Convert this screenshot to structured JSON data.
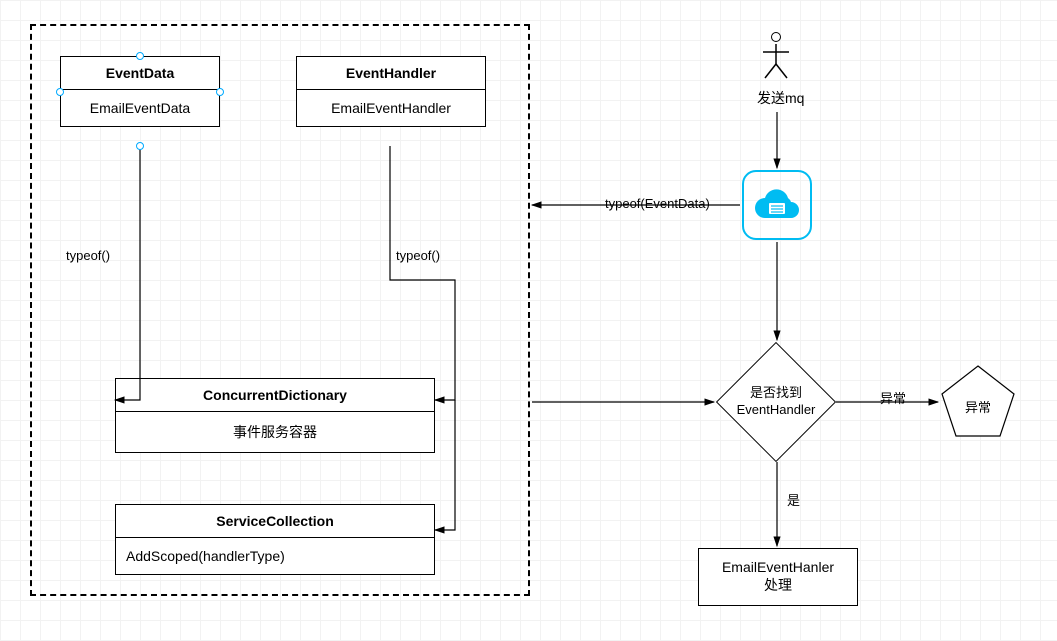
{
  "chart_data": {
    "type": "flowchart",
    "container": "dashed-group",
    "nodes": [
      {
        "id": "eventdata",
        "type": "class-box",
        "title": "EventData",
        "body": "EmailEventData",
        "selected": true
      },
      {
        "id": "eventhandler",
        "type": "class-box",
        "title": "EventHandler",
        "body": "EmailEventHandler"
      },
      {
        "id": "concurrentdict",
        "type": "class-box",
        "title": "ConcurrentDictionary",
        "body": "事件服务容器"
      },
      {
        "id": "servicecoll",
        "type": "class-box",
        "title": "ServiceCollection",
        "body": "AddScoped(handlerType)"
      },
      {
        "id": "actor",
        "type": "actor",
        "label": "发送mq"
      },
      {
        "id": "cloud",
        "type": "cloud-service"
      },
      {
        "id": "decision",
        "type": "diamond",
        "text_line1": "是否找到",
        "text_line2": "EventHandler"
      },
      {
        "id": "exception",
        "type": "pentagon",
        "text": "异常"
      },
      {
        "id": "process",
        "type": "process-box",
        "text_line1": "EmailEventHanler",
        "text_line2": "处理"
      }
    ],
    "edges": [
      {
        "from": "eventdata",
        "to": "concurrentdict",
        "label": "typeof()"
      },
      {
        "from": "eventhandler",
        "to": "concurrentdict",
        "label": "typeof()"
      },
      {
        "from": "eventhandler",
        "to": "servicecoll",
        "label": ""
      },
      {
        "from": "actor",
        "to": "cloud",
        "label": ""
      },
      {
        "from": "cloud",
        "to": "dashed-group",
        "label": "typeof(EventData)"
      },
      {
        "from": "concurrentdict",
        "to": "decision",
        "label": ""
      },
      {
        "from": "decision",
        "to": "exception",
        "label": "异常"
      },
      {
        "from": "decision",
        "to": "process",
        "label": "是"
      }
    ]
  },
  "boxes": {
    "eventdata": {
      "title": "EventData",
      "body": "EmailEventData"
    },
    "eventhandler": {
      "title": "EventHandler",
      "body": "EmailEventHandler"
    },
    "concurrentdict": {
      "title": "ConcurrentDictionary",
      "body": "事件服务容器"
    },
    "servicecoll": {
      "title": "ServiceCollection",
      "body": "AddScoped(handlerType)"
    }
  },
  "labels": {
    "typeof_left": "typeof()",
    "typeof_right": "typeof()",
    "typeof_eventdata": "typeof(EventData)",
    "actor_caption": "发送mq",
    "decision_line1": "是否找到",
    "decision_line2": "EventHandler",
    "edge_exception": "异常",
    "edge_yes": "是",
    "pentagon_text": "异常",
    "process_line1": "EmailEventHanler",
    "process_line2": "处理"
  }
}
